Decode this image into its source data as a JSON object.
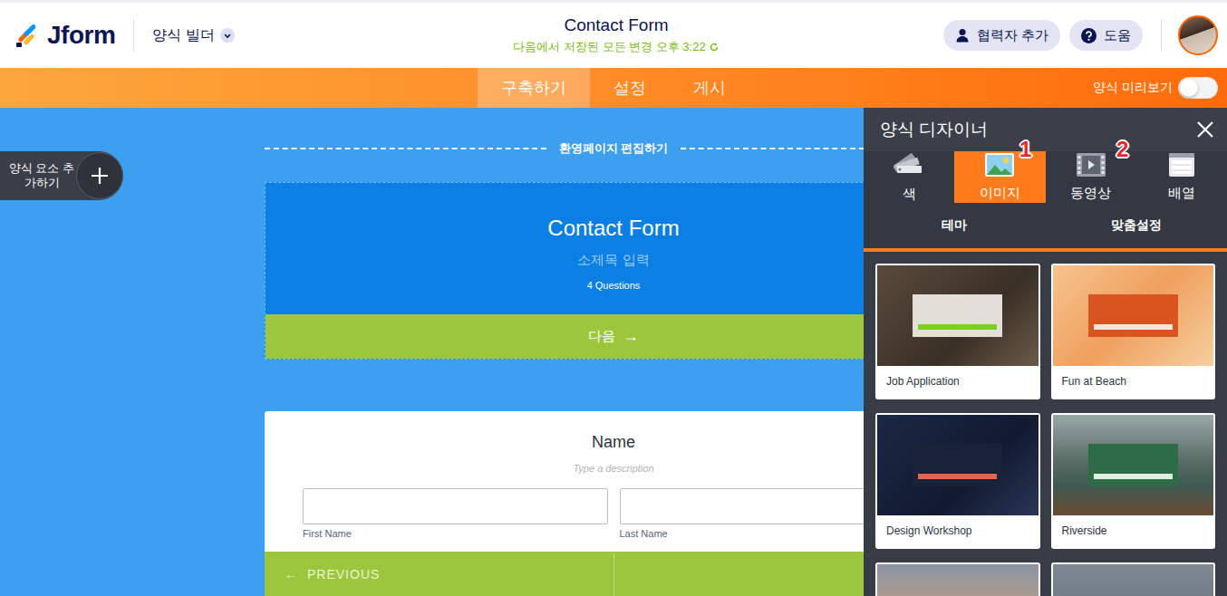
{
  "header": {
    "logo": "Jform",
    "menu": "양식 빌더",
    "title": "Contact Form",
    "save_status": "다음에서 저장된 모든 변경 오후 3:22",
    "buttons": [
      {
        "label": "협력자 추가"
      },
      {
        "label": "도움"
      }
    ]
  },
  "nav": {
    "tabs": [
      {
        "label": "구축하기",
        "selected": true
      },
      {
        "label": "설정",
        "selected": false
      },
      {
        "label": "게시",
        "selected": false
      }
    ],
    "preview": {
      "label": "양식 미리보기",
      "on": false
    }
  },
  "add_element": {
    "label": "양식 요소 추가하기"
  },
  "welcome": {
    "edit_label": "환영페이지 편집하기",
    "title": "Contact Form",
    "subtitle": "소제목 입력",
    "questions": "4 Questions",
    "next": "다음",
    "next_arrow": "→"
  },
  "question": {
    "title": "Name",
    "description": "Type a description",
    "fields": [
      {
        "label": "First Name"
      },
      {
        "label": "Last Name"
      }
    ],
    "previous": "PREVIOUS",
    "previous_arrow": "←"
  },
  "designer": {
    "title": "양식 디자이너",
    "tabs": [
      {
        "label": "색",
        "selected": false
      },
      {
        "label": "이미지",
        "selected": true
      },
      {
        "label": "동영상",
        "selected": false
      },
      {
        "label": "배열",
        "selected": false
      }
    ],
    "annotations": [
      "1",
      "2"
    ],
    "subtabs": [
      "테마",
      "맞춤설정"
    ],
    "themes": [
      {
        "name": "Job Application"
      },
      {
        "name": "Fun at Beach"
      },
      {
        "name": "Design Workshop"
      },
      {
        "name": "Riverside"
      }
    ]
  }
}
